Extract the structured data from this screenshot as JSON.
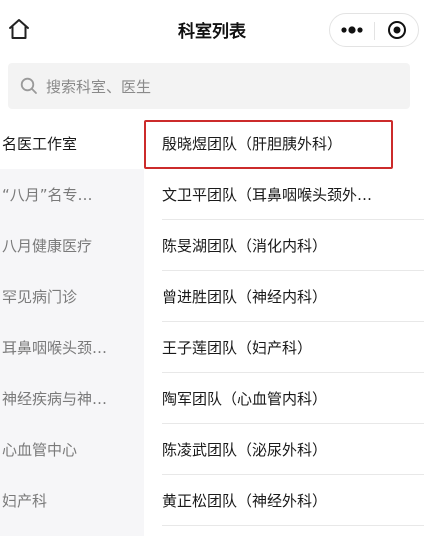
{
  "header": {
    "title": "科室列表",
    "home_icon": "home-icon",
    "more_icon": "more-dots-icon",
    "close_icon": "target-close-icon"
  },
  "search": {
    "placeholder": "搜索科室、医生"
  },
  "categories": [
    {
      "label": "名医工作室",
      "active": true
    },
    {
      "label": "“八月”名专…",
      "active": false
    },
    {
      "label": "八月健康医疗",
      "active": false
    },
    {
      "label": "罕见病门诊",
      "active": false
    },
    {
      "label": "耳鼻咽喉头颈…",
      "active": false
    },
    {
      "label": "神经疾病与神…",
      "active": false
    },
    {
      "label": "心血管中心",
      "active": false
    },
    {
      "label": "妇产科",
      "active": false
    }
  ],
  "teams": [
    {
      "label": "殷晓煜团队（肝胆胰外科）",
      "highlighted": true
    },
    {
      "label": "文卫平团队（耳鼻咽喉头颈外…",
      "highlighted": false
    },
    {
      "label": "陈旻湖团队（消化内科）",
      "highlighted": false
    },
    {
      "label": "曾进胜团队（神经内科）",
      "highlighted": false
    },
    {
      "label": "王子莲团队（妇产科）",
      "highlighted": false
    },
    {
      "label": "陶军团队（心血管内科）",
      "highlighted": false
    },
    {
      "label": "陈凌武团队（泌尿外科）",
      "highlighted": false
    },
    {
      "label": "黄正松团队（神经外科）",
      "highlighted": false
    }
  ],
  "colors": {
    "highlight_border": "#cc2b2b",
    "sidebar_bg": "#f6f6f8",
    "search_bg": "#f3f3f3"
  }
}
